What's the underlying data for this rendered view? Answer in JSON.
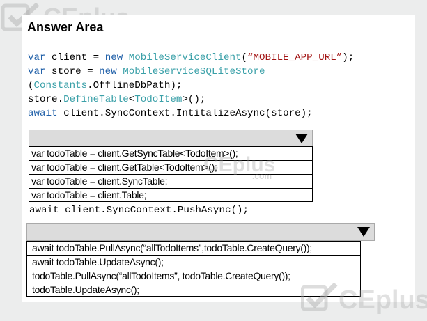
{
  "title": "Answer Area",
  "code_lines": [
    [
      {
        "t": "var",
        "c": "kw"
      },
      {
        "t": " client = ",
        "c": ""
      },
      {
        "t": "new",
        "c": "kw"
      },
      {
        "t": " ",
        "c": ""
      },
      {
        "t": "MobileServiceClient",
        "c": "ty"
      },
      {
        "t": "(",
        "c": ""
      },
      {
        "t": "“MOBILE_APP_URL”",
        "c": "st"
      },
      {
        "t": ");",
        "c": ""
      }
    ],
    [
      {
        "t": "var",
        "c": "kw"
      },
      {
        "t": " store = ",
        "c": ""
      },
      {
        "t": "new",
        "c": "kw"
      },
      {
        "t": " ",
        "c": ""
      },
      {
        "t": "MobileServiceSQLiteStore",
        "c": "ty"
      }
    ],
    [
      {
        "t": "(",
        "c": ""
      },
      {
        "t": "Constants",
        "c": "ty"
      },
      {
        "t": ".OfflineDbPath);",
        "c": ""
      }
    ],
    [
      {
        "t": "store.",
        "c": ""
      },
      {
        "t": "DefineTable",
        "c": "ty"
      },
      {
        "t": "<",
        "c": ""
      },
      {
        "t": "TodoItem",
        "c": "ty"
      },
      {
        "t": ">();",
        "c": ""
      }
    ],
    [
      {
        "t": "await",
        "c": "kw"
      },
      {
        "t": " client.SyncContext.IntitalizeAsync(store);",
        "c": ""
      }
    ]
  ],
  "code_after": "await client.SyncContext.PushAsync();",
  "dropdown1": {
    "options": [
      "var todoTable = client.GetSyncTable<TodoItem>();",
      "var todoTable = client.GetTable<TodoItem>();",
      "var todoTable = client.SyncTable;",
      "var todoTable = client.Table;"
    ]
  },
  "dropdown2": {
    "options": [
      "await todoTable.PullAsync(“allTodoItems”,todoTable.CreateQuery());",
      "await todoTable.UpdateAsync();",
      "todoTable.PullAsync(“allTodoItems”, todoTable.CreateQuery());",
      "todoTable.UpdateAsync();"
    ]
  },
  "watermark": {
    "brand": "CEplus",
    "domain": ".com"
  },
  "colors": {
    "keyword": "#1f5fa8",
    "type": "#3aa0a8",
    "string": "#a31515",
    "dropdown_bg": "#dcdcdc"
  }
}
